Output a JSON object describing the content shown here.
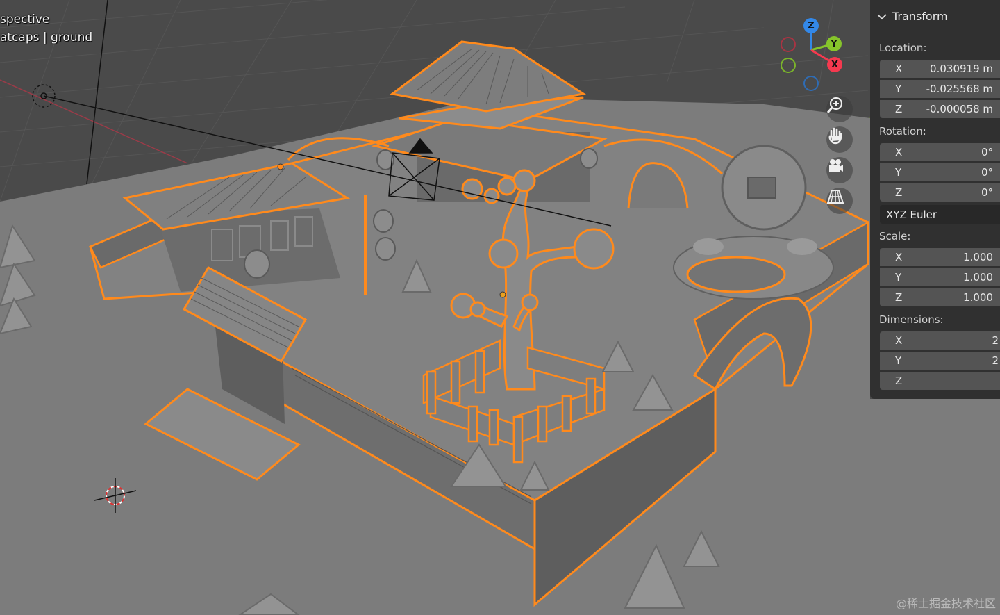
{
  "viewport": {
    "overlay_line1": "spective",
    "overlay_line2": "atcaps | ground",
    "watermark": "@稀土掘金技术社区",
    "colors": {
      "background": "#4a4a4a",
      "ground": "#7c7c7c",
      "selection_outline": "#ff8a1c",
      "grid": "#555555",
      "x_axis": "#9b3b48",
      "y_axis": "#6f9a2a"
    }
  },
  "gizmo": {
    "z_label": "Z",
    "y_label": "Y",
    "x_label": "X",
    "colors": {
      "x": "#f5394f",
      "y": "#86c42b",
      "z": "#3388e8"
    }
  },
  "nav_buttons": {
    "zoom": "zoom-icon",
    "pan": "hand-icon",
    "camera": "camera-icon",
    "ortho": "grid-icon"
  },
  "transform": {
    "title": "Transform",
    "location_label": "Location:",
    "location": [
      {
        "axis": "X",
        "value": "0.030919 m"
      },
      {
        "axis": "Y",
        "value": "-0.025568 m"
      },
      {
        "axis": "Z",
        "value": "-0.000058 m"
      }
    ],
    "rotation_label": "Rotation:",
    "rotation": [
      {
        "axis": "X",
        "value": "0°"
      },
      {
        "axis": "Y",
        "value": "0°"
      },
      {
        "axis": "Z",
        "value": "0°"
      }
    ],
    "rotation_mode": "XYZ Euler",
    "scale_label": "Scale:",
    "scale": [
      {
        "axis": "X",
        "value": "1.000"
      },
      {
        "axis": "Y",
        "value": "1.000"
      },
      {
        "axis": "Z",
        "value": "1.000"
      }
    ],
    "dimensions_label": "Dimensions:",
    "dimensions": [
      {
        "axis": "X",
        "value": "2"
      },
      {
        "axis": "Y",
        "value": "2"
      },
      {
        "axis": "Z",
        "value": ""
      }
    ]
  }
}
